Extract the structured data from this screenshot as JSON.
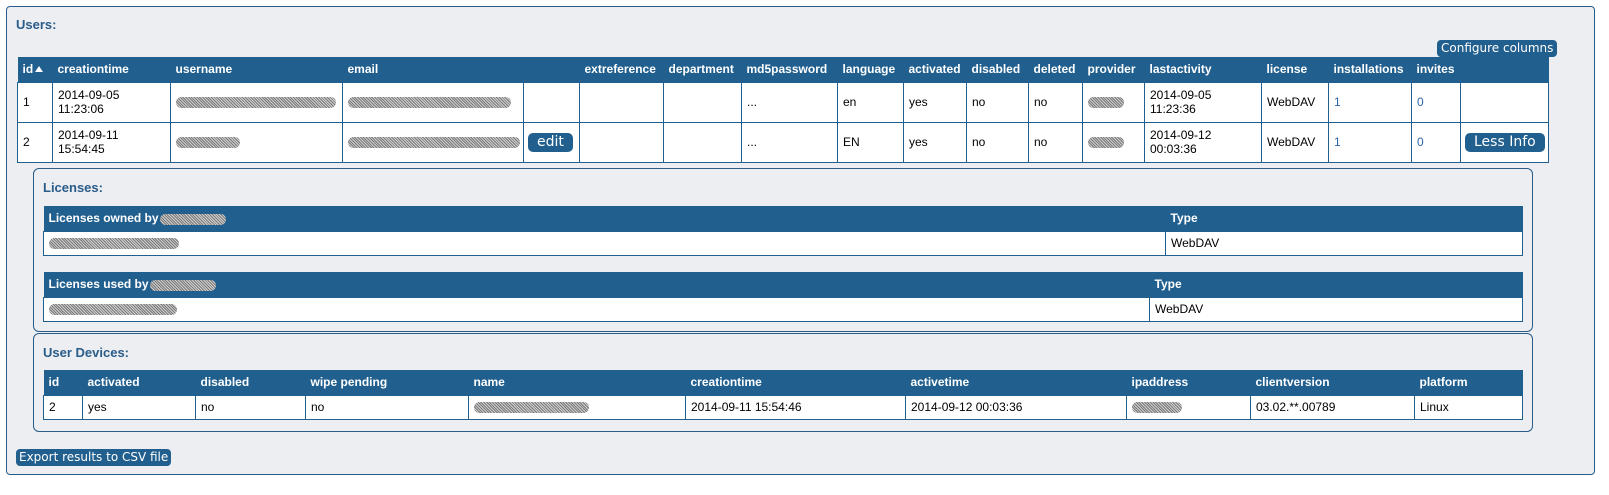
{
  "users": {
    "title": "Users:",
    "configure_columns_label": "Configure columns",
    "columns": [
      "id",
      "creationtime",
      "username",
      "email",
      "",
      "extreference",
      "department",
      "md5password",
      "language",
      "activated",
      "disabled",
      "deleted",
      "provider",
      "lastactivity",
      "license",
      "installations",
      "invites",
      ""
    ],
    "rows": [
      {
        "id": "1",
        "creationtime_date": "2014-09-05",
        "creationtime_time": "11:23:06",
        "md5password": "...",
        "language": "en",
        "activated": "yes",
        "disabled": "no",
        "deleted": "no",
        "lastactivity_date": "2014-09-05",
        "lastactivity_time": "11:23:36",
        "license": "WebDAV",
        "installations": "1",
        "invites": "0"
      },
      {
        "id": "2",
        "creationtime_date": "2014-09-11",
        "creationtime_time": "15:54:45",
        "edit_label": "edit",
        "md5password": "...",
        "language": "EN",
        "activated": "yes",
        "disabled": "no",
        "deleted": "no",
        "lastactivity_date": "2014-09-12",
        "lastactivity_time": "00:03:36",
        "license": "WebDAV",
        "installations": "1",
        "invites": "0",
        "less_info_label": "Less Info"
      }
    ]
  },
  "licenses": {
    "title": "Licenses:",
    "owned": {
      "header": "Licenses owned by",
      "type_header": "Type",
      "type": "WebDAV"
    },
    "used": {
      "header": "Licenses used by",
      "type_header": "Type",
      "type": "WebDAV"
    }
  },
  "devices": {
    "title": "User Devices:",
    "columns": [
      "id",
      "activated",
      "disabled",
      "wipe pending",
      "name",
      "creationtime",
      "activetime",
      "ipaddress",
      "clientversion",
      "platform"
    ],
    "row": {
      "id": "2",
      "activated": "yes",
      "disabled": "no",
      "wipe_pending": "no",
      "creationtime": "2014-09-11 15:54:46",
      "activetime": "2014-09-12 00:03:36",
      "clientversion": "03.02.**.00789",
      "platform": "Linux"
    }
  },
  "export_label": "Export results to CSV file",
  "colors": {
    "accent": "#215f8e",
    "border": "#2a5c8a",
    "background": "#eceef1",
    "link": "#2a64a8"
  }
}
